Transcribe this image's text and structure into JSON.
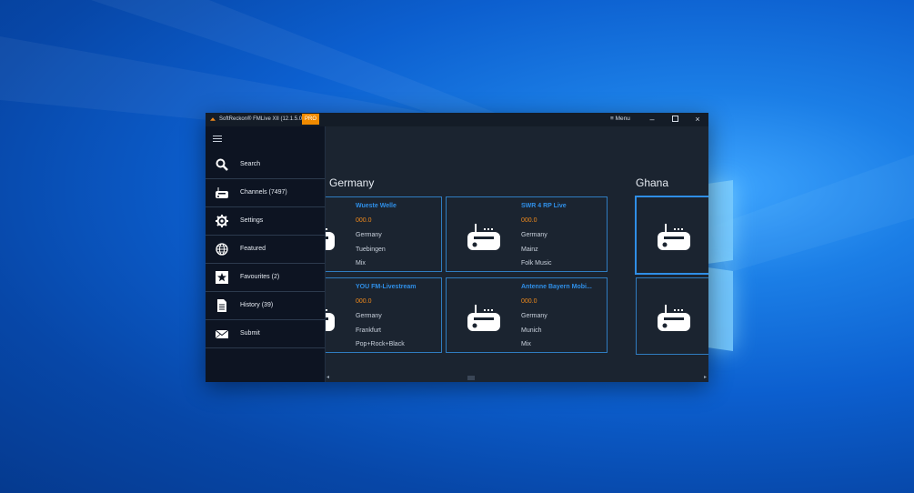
{
  "window": {
    "title": "SoftReckon® FMLive XII (12.1.5.0)",
    "badge": "PRO",
    "menu_label": "Menu",
    "controls": [
      "minimize-icon",
      "maximize-icon",
      "close-icon"
    ]
  },
  "sidebar": {
    "items": [
      {
        "label": "Search",
        "icon": "search-icon"
      },
      {
        "label": "Channels (7497)",
        "icon": "radio-icon"
      },
      {
        "label": "Settings",
        "icon": "gear-icon"
      },
      {
        "label": "Featured",
        "icon": "globe-icon"
      },
      {
        "label": "Favourites (2)",
        "icon": "star-icon"
      },
      {
        "label": "History (39)",
        "icon": "document-icon"
      },
      {
        "label": "Submit",
        "icon": "envelope-icon"
      }
    ]
  },
  "sections": [
    {
      "title": "Germany",
      "stations": [
        {
          "name": "Wueste Welle",
          "freq": "000.0",
          "country": "Germany",
          "city": "Tuebingen",
          "genre": "Mix"
        },
        {
          "name": "SWR 4 RP Live",
          "freq": "000.0",
          "country": "Germany",
          "city": "Mainz",
          "genre": "Folk Music"
        },
        {
          "name": "YOU FM-Livestream",
          "freq": "000.0",
          "country": "Germany",
          "city": "Frankfurt",
          "genre": "Pop+Rock+Black"
        },
        {
          "name": "Antenne Bayern Mobi...",
          "freq": "000.0",
          "country": "Germany",
          "city": "Munich",
          "genre": "Mix"
        }
      ]
    },
    {
      "title": "Ghana",
      "stations": [
        {},
        {}
      ]
    }
  ],
  "colors": {
    "accent": "#2f8fe8",
    "frequency": "#f08a1c",
    "badge": "#f08a00",
    "panel": "#1b2430",
    "drawer": "#0d1422"
  }
}
